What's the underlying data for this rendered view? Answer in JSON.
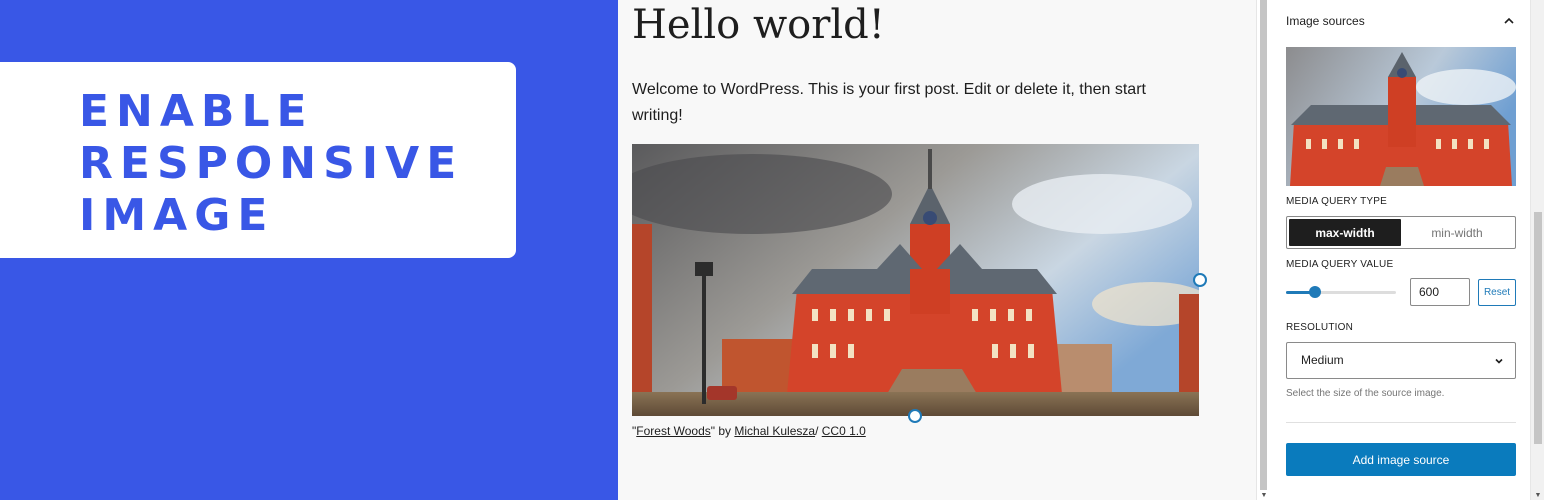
{
  "promo": {
    "lines": [
      "ENABLE",
      "RESPONSIVE",
      "IMAGE"
    ]
  },
  "editor": {
    "post_title": "Hello world!",
    "paragraph": "Welcome to WordPress. This is your first post. Edit or delete it, then start writing!",
    "caption": {
      "quote_open": "\"",
      "title_link": "Forest Woods",
      "quote_by": "\" by ",
      "author_link": "Michal Kulesza",
      "separator": "/ ",
      "license_link": "CC0 1.0"
    }
  },
  "sidebar": {
    "panel_title": "Image sources",
    "media_query_type": {
      "label": "MEDIA QUERY TYPE",
      "options": [
        "max-width",
        "min-width"
      ],
      "selected": "max-width"
    },
    "media_query_value": {
      "label": "MEDIA QUERY VALUE",
      "value": "600",
      "slider_fraction": 0.26,
      "reset_label": "Reset"
    },
    "resolution": {
      "label": "RESOLUTION",
      "selected": "Medium",
      "help": "Select the size of the source image."
    },
    "add_button": "Add image source"
  },
  "colors": {
    "brand_blue": "#3957e6",
    "wp_blue": "#0a7bbd",
    "accent": "#1f7ab8"
  },
  "icons": {
    "panel_toggle": "chevron-up-icon",
    "select_toggle": "chevron-down-icon"
  }
}
